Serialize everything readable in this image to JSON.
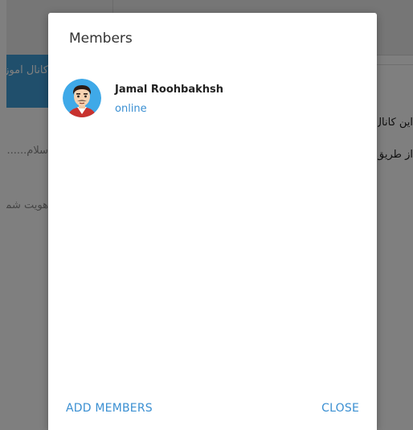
{
  "background": {
    "sidebar": {
      "active_chat_label": "کانال آموزش",
      "line1": "سلام......",
      "line2": "هویت شما"
    },
    "main": {
      "line1": "این کانال",
      "line2": "از طریق این"
    }
  },
  "modal": {
    "title": "Members",
    "members": [
      {
        "name": "Jamal Roohbakhsh",
        "status": "online"
      }
    ],
    "add_members_label": "ADD MEMBERS",
    "close_label": "CLOSE"
  },
  "colors": {
    "accent": "#3a8fd2",
    "sidebar_active": "#419fd9",
    "overlay": "rgba(0,0,0,0.5)"
  }
}
